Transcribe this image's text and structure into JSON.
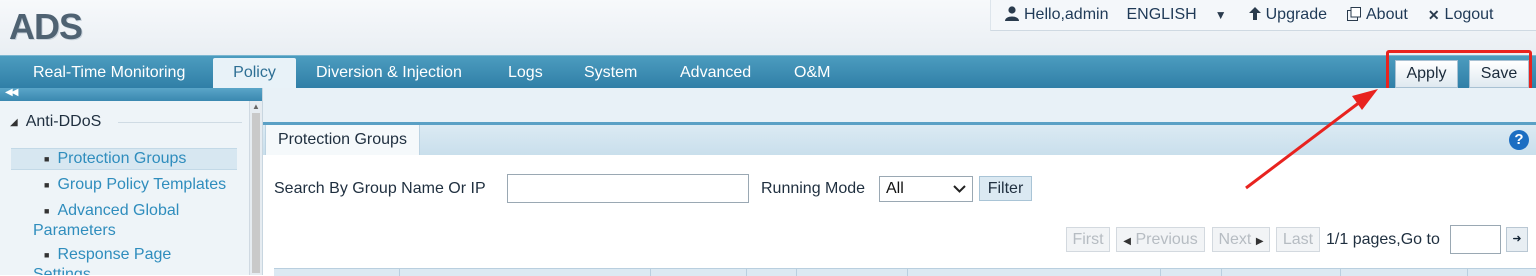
{
  "header": {
    "logo": "ADS",
    "user": "Hello,admin",
    "language": "ENGLISH",
    "upgrade": "Upgrade",
    "about": "About",
    "logout": "Logout"
  },
  "nav": {
    "tabs": [
      {
        "label": "Real-Time Monitoring"
      },
      {
        "label": "Policy"
      },
      {
        "label": "Diversion & Injection"
      },
      {
        "label": "Logs"
      },
      {
        "label": "System"
      },
      {
        "label": "Advanced"
      },
      {
        "label": "O&M"
      }
    ],
    "active_tab": "Policy",
    "apply_label": "Apply",
    "save_label": "Save"
  },
  "sidebar": {
    "group": "Anti-DDoS",
    "items": [
      {
        "label": "Protection Groups",
        "selected": true
      },
      {
        "label": "Group Policy Templates"
      },
      {
        "label_line1": "Advanced Global",
        "label_line2": "Parameters"
      },
      {
        "label_line1": "Response Page",
        "label_line2": "Settings"
      }
    ]
  },
  "panel": {
    "tab": "Protection Groups",
    "help_icon": "?",
    "search_label": "Search By Group Name Or IP",
    "search_value": "",
    "mode_label": "Running Mode",
    "mode_value": "All",
    "filter_label": "Filter",
    "pagination": {
      "first": "First",
      "previous": "Previous",
      "next": "Next",
      "last": "Last",
      "info": "1/1 pages,Go to",
      "goto_value": ""
    }
  },
  "colors": {
    "nav_bg": "#3a8ab2",
    "highlight": "#e8231f",
    "link": "#2f8dbd",
    "help": "#1c6ec2"
  },
  "icons": [
    "user-icon",
    "chevron-down-icon",
    "upgrade-icon",
    "about-icon",
    "close-icon",
    "collapse-icon",
    "triangle-down-icon",
    "help-icon",
    "arrow-right-icon"
  ]
}
